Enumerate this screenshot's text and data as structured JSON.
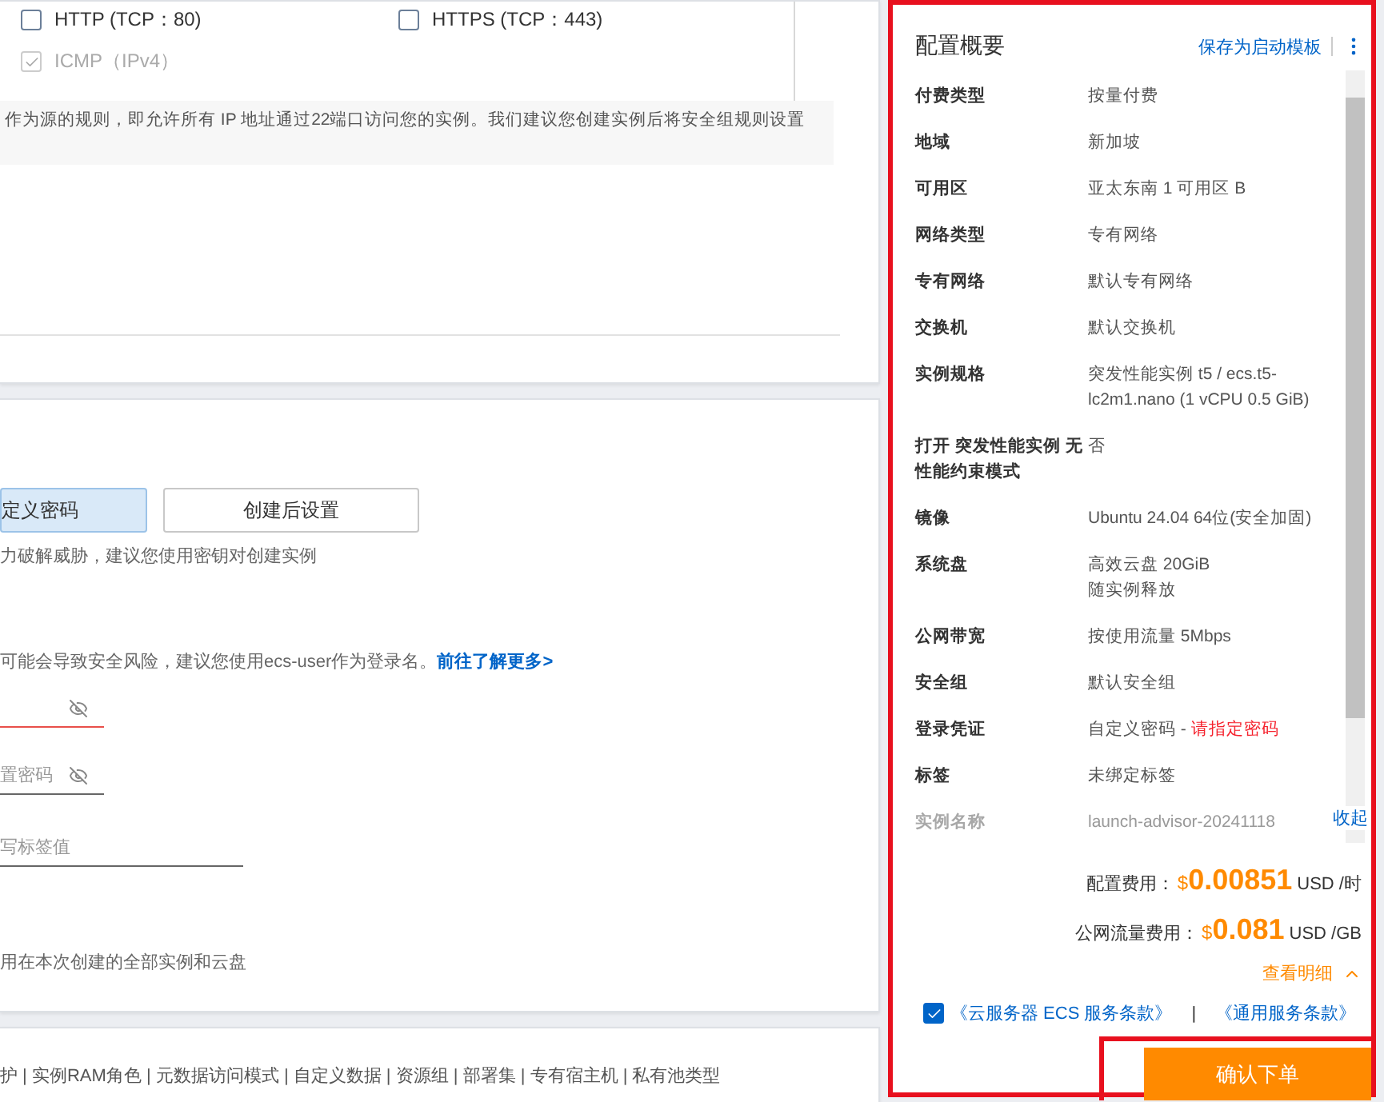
{
  "ports": {
    "options": [
      {
        "label": "HTTP (TCP：80)",
        "checked": false,
        "disabled": false
      },
      {
        "label": "HTTPS (TCP：443)",
        "checked": false,
        "disabled": false
      },
      {
        "label": "ICMP（IPv4）",
        "checked": true,
        "disabled": true
      }
    ],
    "note": "作为源的规则，即允许所有 IP 地址通过22端口访问您的实例。我们建议您创建实例后将安全组规则设置"
  },
  "login": {
    "modes": [
      {
        "label": "定义密码",
        "selected": true
      },
      {
        "label": "创建后设置",
        "selected": false
      }
    ],
    "mode_hint": "力破解威胁，建议您使用密钥对创建实例",
    "user_hint": "可能会导致安全风险，建议您使用ecs-user作为登录名。",
    "user_hint_link": "前往了解更多>",
    "password": {
      "error": true
    },
    "confirm_password": {
      "placeholder": "置密码",
      "error": false
    },
    "tag_value": {
      "placeholder": "写标签值"
    },
    "tag_hint": "用在本次创建的全部实例和云盘"
  },
  "advanced": {
    "text": "护 | 实例RAM角色 | 元数据访问模式 | 自定义数据 | 资源组 | 部署集 | 专有宿主机 | 私有池类型"
  },
  "summary": {
    "title": "配置概要",
    "save_template": "保存为启动模板",
    "rows": [
      {
        "label": "付费类型",
        "lines": [
          "按量付费"
        ],
        "faded": false
      },
      {
        "label": "地域",
        "lines": [
          "新加坡"
        ],
        "faded": false
      },
      {
        "label": "可用区",
        "lines": [
          "亚太东南 1 可用区 B"
        ],
        "faded": false
      },
      {
        "label": "网络类型",
        "lines": [
          "专有网络"
        ],
        "faded": false
      },
      {
        "label": "专有网络",
        "lines": [
          "默认专有网络"
        ],
        "faded": false
      },
      {
        "label": "交换机",
        "lines": [
          "默认交换机"
        ],
        "faded": false
      },
      {
        "label": "实例规格",
        "lines": [
          "突发性能实例 t5 / ecs.t5-lc2m1.nano (1 vCPU 0.5 GiB)"
        ],
        "faded": false
      },
      {
        "label": "打开 突发性能实例 无性能约束模式",
        "lines": [
          "否"
        ],
        "faded": false
      },
      {
        "label": "镜像",
        "lines": [
          "Ubuntu 24.04 64位(安全加固)"
        ],
        "faded": false
      },
      {
        "label": "系统盘",
        "lines": [
          "高效云盘 20GiB",
          "随实例释放"
        ],
        "faded": false
      },
      {
        "label": "公网带宽",
        "lines": [
          "按使用流量 5Mbps"
        ],
        "faded": false
      },
      {
        "label": "安全组",
        "lines": [
          "默认安全组"
        ],
        "faded": false
      },
      {
        "label": "登录凭证",
        "lines": [
          "自定义密码 - "
        ],
        "warning": "请指定密码",
        "faded": false
      },
      {
        "label": "标签",
        "lines": [
          "未绑定标签"
        ],
        "faded": false
      },
      {
        "label": "实例名称",
        "lines": [
          "launch-advisor-20241118"
        ],
        "faded": true
      }
    ],
    "collapse": "收起",
    "fees": [
      {
        "label": "配置费用：",
        "currency": "$",
        "amount": "0.00851",
        "unit": "USD /时"
      },
      {
        "label": "公网流量费用：",
        "currency": "$",
        "amount": "0.081",
        "unit": "USD /GB"
      }
    ],
    "details_link": {
      "label": "查看明细",
      "expanded": true
    },
    "terms": {
      "checked": true,
      "links": [
        "《云服务器 ECS 服务条款》",
        "《通用服务条款》"
      ],
      "separator": "|"
    },
    "submit": "确认下单"
  }
}
